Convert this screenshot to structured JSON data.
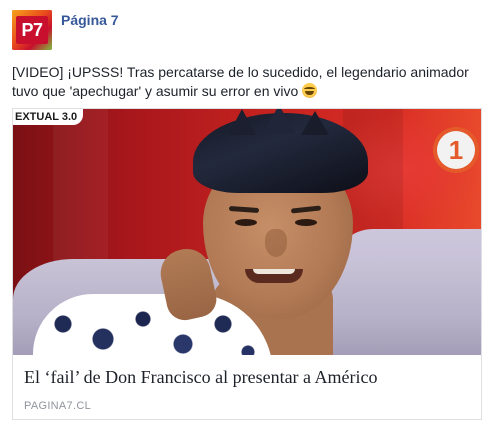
{
  "post": {
    "page_name": "Página 7",
    "avatar_label": "P7",
    "text": "[VIDEO] ¡UPSSS! Tras percatarse de lo sucedido, el legendario animador tuvo que 'apechugar' y asumir su error en vivo",
    "emoji": "laughing-tears-emoji"
  },
  "link_card": {
    "chyron": "EXTUAL 3.0",
    "channel_logo": "1",
    "title": "El ‘fail’ de Don Francisco al presentar a Américo",
    "domain": "PAGINA7.CL"
  },
  "colors": {
    "page_name": "#365899",
    "text": "#1d2129",
    "domain": "#90949c",
    "card_border": "#dddfe2"
  }
}
